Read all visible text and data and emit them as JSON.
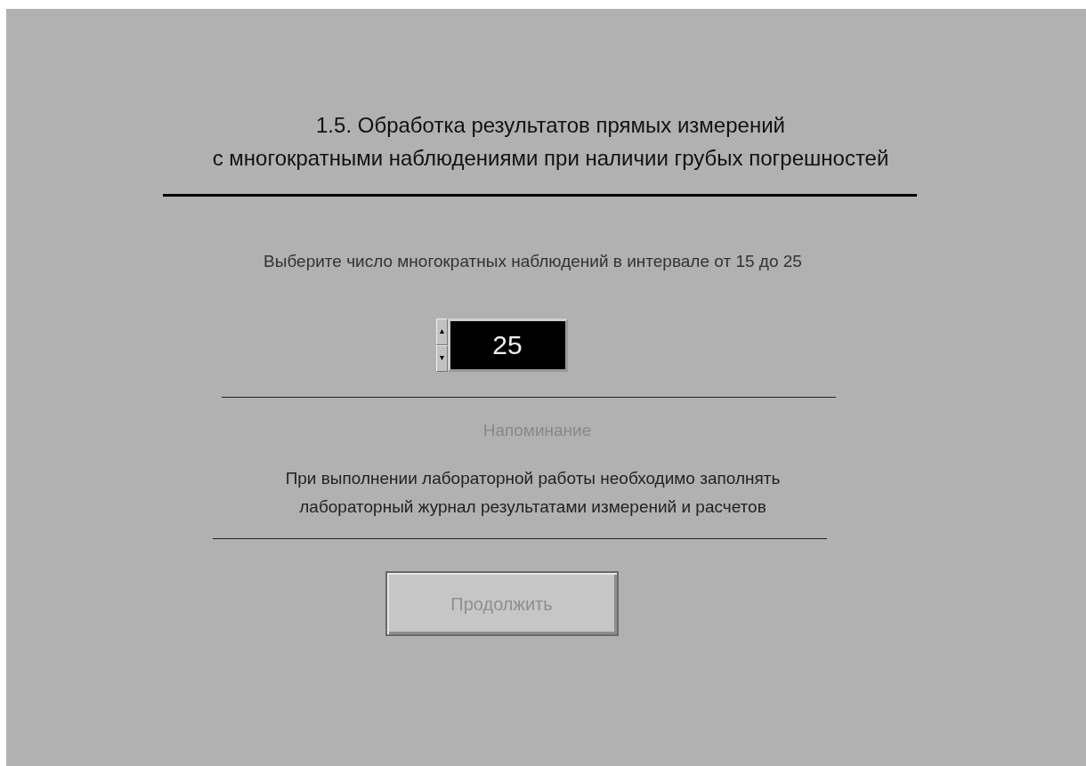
{
  "title_lines": [
    "1.5. Обработка результатов прямых измерений",
    "с многократными наблюдениями при наличии грубых погрешностей"
  ],
  "prompt": "Выберите число многократных наблюдений в интервале от 15 до 25",
  "count_field": {
    "value": "25"
  },
  "reminder": {
    "heading": "Напоминание",
    "lines": [
      "При выполнении лабораторной работы необходимо заполнять",
      "лабораторный журнал результатами измерений и расчетов"
    ]
  },
  "continue_button": {
    "label": "Продолжить",
    "disabled": true
  }
}
